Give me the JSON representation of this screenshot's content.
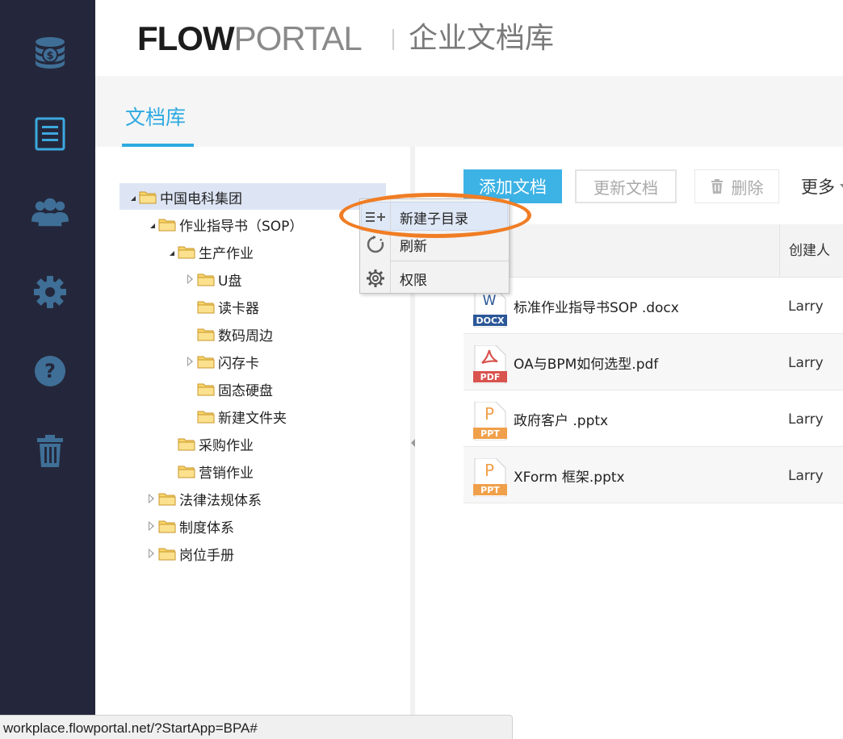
{
  "header": {
    "logo_flow": "FLOW",
    "logo_portal": "PORTAL",
    "app_title": "企业文档库"
  },
  "rail": {
    "items": [
      {
        "icon": "money-stack-icon"
      },
      {
        "icon": "document-list-icon"
      },
      {
        "icon": "users-icon"
      },
      {
        "icon": "gear-icon"
      },
      {
        "icon": "help-icon"
      },
      {
        "icon": "trash-icon"
      }
    ],
    "active_index": 1,
    "colors": {
      "inactive": "#3f6f97",
      "active": "#3da8df"
    }
  },
  "tabs": [
    {
      "label": "文档库",
      "active": true
    }
  ],
  "tree": {
    "nodes": [
      {
        "label": "中国电科集团",
        "state": "expanded",
        "selected": true
      },
      {
        "label": "作业指导书（SOP）",
        "state": "expanded"
      },
      {
        "label": "生产作业",
        "state": "expanded"
      },
      {
        "label": "U盘",
        "state": "collapsed"
      },
      {
        "label": "读卡器",
        "state": "leaf"
      },
      {
        "label": "数码周边",
        "state": "leaf"
      },
      {
        "label": "闪存卡",
        "state": "collapsed"
      },
      {
        "label": "固态硬盘",
        "state": "leaf"
      },
      {
        "label": "新建文件夹",
        "state": "leaf"
      },
      {
        "label": "采购作业",
        "state": "leaf"
      },
      {
        "label": "营销作业",
        "state": "leaf"
      },
      {
        "label": "法律法规体系",
        "state": "collapsed"
      },
      {
        "label": "制度体系",
        "state": "collapsed"
      },
      {
        "label": "岗位手册",
        "state": "collapsed"
      }
    ]
  },
  "toolbar": {
    "add_label": "添加文档",
    "update_label": "更新文档",
    "delete_label": "删除",
    "more_label": "更多"
  },
  "table": {
    "col_creator": "创建人",
    "rows": [
      {
        "name": "标准作业指导书SOP .docx",
        "type": "docx",
        "badge_letter": "W",
        "badge_text": "DOCX",
        "creator": "Larry"
      },
      {
        "name": "OA与BPM如何选型.pdf",
        "type": "pdf",
        "badge_letter": "",
        "badge_text": "PDF",
        "creator": "Larry"
      },
      {
        "name": "政府客户 .pptx",
        "type": "ppt",
        "badge_letter": "P",
        "badge_text": "PPT",
        "creator": "Larry"
      },
      {
        "name": "XForm 框架.pptx",
        "type": "ppt",
        "badge_letter": "P",
        "badge_text": "PPT",
        "creator": "Larry"
      }
    ]
  },
  "context_menu": {
    "items": [
      {
        "label": "新建子目录",
        "icon": "add-list-icon",
        "highlighted": true
      },
      {
        "label": "刷新",
        "icon": "refresh-icon"
      },
      {
        "label": "权限",
        "icon": "gear-icon"
      }
    ],
    "highlight_ring_color": "#f07d24"
  },
  "status_bar": {
    "url": "workplace.flowportal.net/?StartApp=BPA#"
  }
}
